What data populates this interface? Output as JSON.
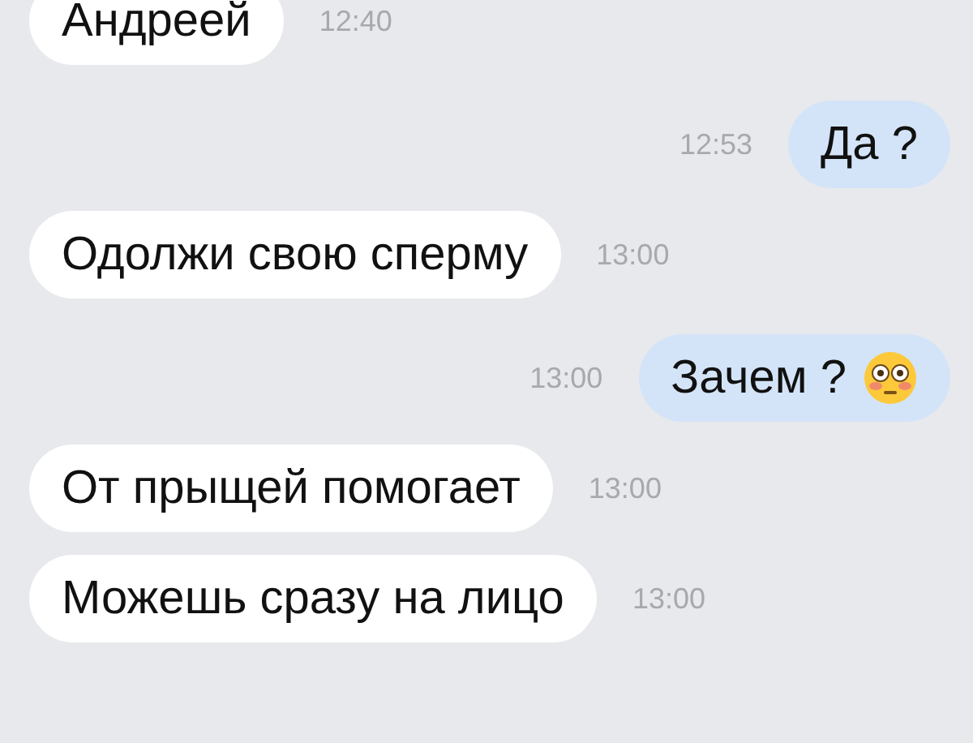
{
  "messages": [
    {
      "kind": "received",
      "text": "Андреей",
      "time": "12:40",
      "emoji": false
    },
    {
      "kind": "sent",
      "text": "Да ?",
      "time": "12:53",
      "emoji": false
    },
    {
      "kind": "received",
      "text": "Одолжи свою сперму",
      "time": "13:00",
      "emoji": false
    },
    {
      "kind": "sent",
      "text": "Зачем ?",
      "time": "13:00",
      "emoji": true
    },
    {
      "kind": "received",
      "text": "От прыщей помогает",
      "time": "13:00",
      "emoji": false
    },
    {
      "kind": "received",
      "text": "Можешь сразу на лицо",
      "time": "13:00",
      "emoji": false
    }
  ]
}
